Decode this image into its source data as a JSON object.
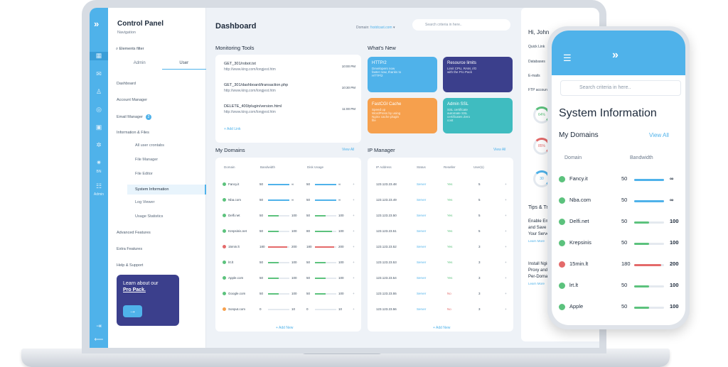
{
  "sidebar": {
    "title": "Control Panel",
    "navigation_label": "Navigation",
    "filter_placeholder": "Elements filter",
    "tabs": [
      "Admin",
      "User"
    ],
    "menu": [
      "Dashboard",
      "Account Manager",
      "Email Manager",
      "Information & Files",
      "All user crontabs",
      "File Manager",
      "File Editor",
      "System Information",
      "Log Viewer",
      "Usage Statistics",
      "Advanced Features",
      "Extra Features",
      "Help & Support"
    ],
    "email_badge": "2",
    "rail_labels": [
      "BN",
      "Admin"
    ],
    "promo": {
      "line1": "Learn about our",
      "line2": "Pro Pack."
    }
  },
  "header": {
    "title": "Dashboard",
    "domain_label": "Domain:",
    "domain_value": "fxstdcast.com",
    "search_placeholder": "Search criteria in here..",
    "user": "Hi, John"
  },
  "monitoring": {
    "title": "Monitoring Tools",
    "items": [
      {
        "req": "GET_301/robot.txt",
        "url": "http://www.king.com/longjest.htm",
        "time": "10:00 PM"
      },
      {
        "req": "GET_301/dashboard/transaction.php",
        "url": "http://www.king.com/longjest.htm",
        "time": "10:30 PM"
      },
      {
        "req": "DELETE_400/plugin/version.html",
        "url": "http://www.king.com/longjest.htm",
        "time": "11:00 PM"
      }
    ],
    "add_link": "Add Link"
  },
  "whats_new": {
    "title": "What's New",
    "tiles": [
      {
        "title": "HTTP/2",
        "body": "Developers now faster now, thanks to HTTP/2",
        "color": "#4fb2ea"
      },
      {
        "title": "Resource limits",
        "body": "Limit CPU, RAM, I/O with the Pro Pack",
        "color": "#3b3f8c"
      },
      {
        "title": "FastCGI Cache",
        "body": "Speed up WordPress by using Nginx cache plugin file",
        "color": "#f6a04d"
      },
      {
        "title": "Admin SSL",
        "body": "SSL certificate automate SSL certificates Zero cost",
        "color": "#3fbcc0"
      }
    ]
  },
  "domains": {
    "title": "My Domains",
    "view_all": "View All",
    "headers": [
      "Domain",
      "Bandwidth",
      "Disk Usage"
    ],
    "rows": [
      {
        "name": "Fancy.it",
        "bw": "50",
        "bwmax": "∞",
        "disk": "50",
        "dmax": "∞",
        "status": "ok",
        "bwc": "#4fb2ea",
        "dc": "#4fb2ea"
      },
      {
        "name": "Nba.com",
        "bw": "50",
        "bwmax": "∞",
        "disk": "50",
        "dmax": "∞",
        "status": "ok",
        "bwc": "#4fb2ea",
        "dc": "#4fb2ea"
      },
      {
        "name": "Delfi.net",
        "bw": "50",
        "bwmax": "100",
        "disk": "50",
        "dmax": "100",
        "status": "ok",
        "bwc": "#5cc27d",
        "dc": "#5cc27d"
      },
      {
        "name": "Krepsinis.net",
        "bw": "50",
        "bwmax": "100",
        "disk": "80",
        "dmax": "100",
        "status": "ok",
        "bwc": "#5cc27d",
        "dc": "#5cc27d"
      },
      {
        "name": "15min.lt",
        "bw": "180",
        "bwmax": "200",
        "disk": "180",
        "dmax": "200",
        "status": "err",
        "bwc": "#e46a6a",
        "dc": "#e46a6a"
      },
      {
        "name": "lrt.lt",
        "bw": "50",
        "bwmax": "100",
        "disk": "50",
        "dmax": "100",
        "status": "ok",
        "bwc": "#5cc27d",
        "dc": "#5cc27d"
      },
      {
        "name": "Apple.com",
        "bw": "50",
        "bwmax": "100",
        "disk": "50",
        "dmax": "100",
        "status": "ok",
        "bwc": "#5cc27d",
        "dc": "#5cc27d"
      },
      {
        "name": "Google.com",
        "bw": "50",
        "bwmax": "100",
        "disk": "50",
        "dmax": "100",
        "status": "ok",
        "bwc": "#5cc27d",
        "dc": "#5cc27d"
      },
      {
        "name": "Sonput.com",
        "bw": "0",
        "bwmax": "10",
        "disk": "0",
        "dmax": "10",
        "status": "warn",
        "bwc": "#f6a04d",
        "dc": "#f6a04d"
      }
    ],
    "add": "Add New"
  },
  "ip": {
    "title": "IP Manager",
    "view_all": "View All",
    "headers": [
      "IP Address",
      "Status",
      "Reseller",
      "User(s)"
    ],
    "rows": [
      {
        "ip": "123.123.23.48",
        "status": "Server",
        "res": "Yes",
        "users": "5"
      },
      {
        "ip": "123.123.23.49",
        "status": "Server",
        "res": "Yes",
        "users": "5"
      },
      {
        "ip": "123.123.23.50",
        "status": "Server",
        "res": "Yes",
        "users": "5"
      },
      {
        "ip": "123.123.23.51",
        "status": "Server",
        "res": "Yes",
        "users": "5"
      },
      {
        "ip": "123.123.23.52",
        "status": "Server",
        "res": "Yes",
        "users": "3"
      },
      {
        "ip": "123.123.23.53",
        "status": "Server",
        "res": "Yes",
        "users": "3"
      },
      {
        "ip": "123.123.23.54",
        "status": "Server",
        "res": "Yes",
        "users": "3"
      },
      {
        "ip": "123.123.23.55",
        "status": "Server",
        "res": "No",
        "users": "3"
      },
      {
        "ip": "123.123.23.56",
        "status": "Server",
        "res": "No",
        "users": "3"
      }
    ],
    "add": "Add New"
  },
  "right": {
    "quick_link": "Quick Link",
    "items": [
      "Databases",
      "E-mails",
      "FTP accounts"
    ],
    "gauges": [
      {
        "val": "64%",
        "color": "#5cc27d"
      },
      {
        "val": "85%",
        "color": "#e46a6a"
      },
      {
        "val": "30",
        "color": "#4fb2ea"
      }
    ],
    "tips_title": "Tips & Tricks",
    "tip1": [
      "Enable Email",
      "and Save Disk",
      "Your Server"
    ],
    "tip2": [
      "Install Nginx",
      "Proxy and C",
      "Per-Domain"
    ],
    "learn_more": "Learn More"
  },
  "phone": {
    "search_placeholder": "Search criteria in here..",
    "title": "System Information",
    "section": "My Domains",
    "view_all": "View All",
    "headers": [
      "Domain",
      "Bandwidth"
    ],
    "rows": [
      {
        "name": "Fancy.it",
        "val": "50",
        "max": "∞",
        "status": "ok",
        "color": "#4fb2ea",
        "fill": 1.0
      },
      {
        "name": "Nba.com",
        "val": "50",
        "max": "∞",
        "status": "ok",
        "color": "#4fb2ea",
        "fill": 1.0
      },
      {
        "name": "Delfi.net",
        "val": "50",
        "max": "100",
        "status": "ok",
        "color": "#5cc27d",
        "fill": 0.5
      },
      {
        "name": "Krepsinis",
        "val": "50",
        "max": "100",
        "status": "ok",
        "color": "#5cc27d",
        "fill": 0.5
      },
      {
        "name": "15min.lt",
        "val": "180",
        "max": "200",
        "status": "err",
        "color": "#e46a6a",
        "fill": 0.9
      },
      {
        "name": "lrt.lt",
        "val": "50",
        "max": "100",
        "status": "ok",
        "color": "#5cc27d",
        "fill": 0.5
      },
      {
        "name": "Apple",
        "val": "50",
        "max": "100",
        "status": "ok",
        "color": "#5cc27d",
        "fill": 0.5
      }
    ]
  }
}
